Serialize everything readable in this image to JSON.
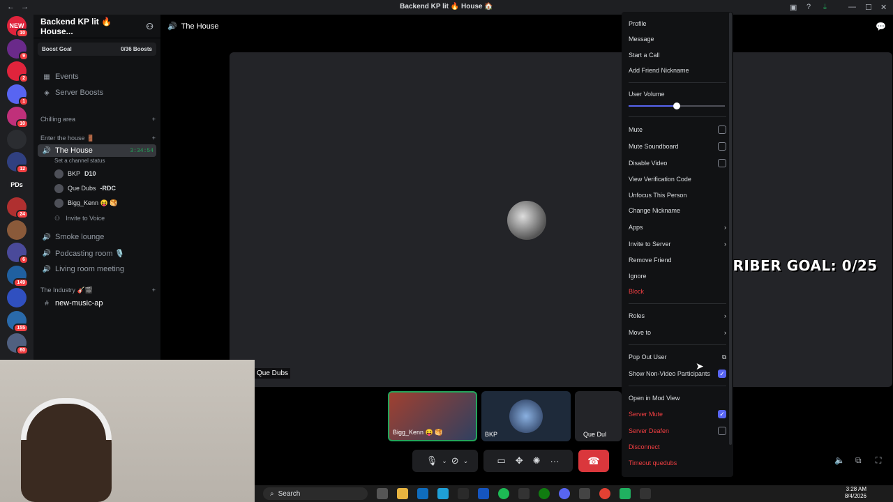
{
  "titlebar": {
    "title": "Backend KP lit 🔥 House 🏠"
  },
  "servers": [
    {
      "label": "NEW",
      "badge": "10",
      "color": "#e0243c"
    },
    {
      "label": "",
      "badge": "9",
      "color": "#6a2a8a"
    },
    {
      "label": "",
      "badge": "2",
      "color": "#e0243c"
    },
    {
      "label": "",
      "badge": "1",
      "color": "#5865f2"
    },
    {
      "label": "",
      "badge": "10",
      "color": "#c0307a"
    },
    {
      "label": "",
      "badge": "",
      "color": "#2b2d31"
    },
    {
      "label": "",
      "badge": "12",
      "color": "#304080"
    },
    {
      "label": "PDs",
      "badge": "",
      "color": "#1e1f22"
    },
    {
      "label": "",
      "badge": "24",
      "color": "#b03030"
    },
    {
      "label": "",
      "badge": "",
      "color": "#8a5a3a"
    },
    {
      "label": "",
      "badge": "6",
      "color": "#4a4a9a"
    },
    {
      "label": "",
      "badge": "149",
      "color": "#2060a0"
    },
    {
      "label": "",
      "badge": "",
      "color": "#3050c0"
    },
    {
      "label": "",
      "badge": "155",
      "color": "#2a6aaa"
    },
    {
      "label": "",
      "badge": "60",
      "color": "#506080"
    }
  ],
  "guild": {
    "name": "Backend KP lit 🔥 House...",
    "boost_label": "Boost Goal",
    "boost_count": "0/36 Boosts"
  },
  "channels": {
    "events": "Events",
    "server_boosts": "Server Boosts",
    "cat_chilling": "Chilling area",
    "cat_enter": "Enter the house 🚪",
    "the_house": "The House",
    "the_house_time": "3:34:54",
    "channel_status": "Set a channel status",
    "voice_users": [
      {
        "name": "BKP",
        "tag": "D10"
      },
      {
        "name": "Que Dubs",
        "tag": "-RDC"
      },
      {
        "name": "Bigg_Kenn 😝 🥞",
        "tag": ""
      }
    ],
    "invite": "Invite to Voice",
    "smoke_lounge": "Smoke lounge",
    "podcasting": "Podcasting room 🎙️",
    "living_room": "Living room meeting",
    "cat_industry": "The Industry 🎸🎬",
    "new_music": "new-music-ap"
  },
  "main": {
    "header": "The House",
    "overlay_text": "SUBSCRIBER GOAL: 0/25",
    "quedubs_label": "Que Dubs",
    "tiles": [
      {
        "label": "Bigg_Kenn 😝 🥞"
      },
      {
        "label": "BKP"
      },
      {
        "label": "Que Dul"
      }
    ]
  },
  "menu": {
    "profile": "Profile",
    "message": "Message",
    "start_call": "Start a Call",
    "add_nickname": "Add Friend Nickname",
    "user_volume": "User Volume",
    "user_volume_level": 0.5,
    "mute": "Mute",
    "mute_soundboard": "Mute Soundboard",
    "disable_video": "Disable Video",
    "view_verification": "View Verification Code",
    "unfocus": "Unfocus This Person",
    "change_nickname": "Change Nickname",
    "apps": "Apps",
    "invite_server": "Invite to Server",
    "remove_friend": "Remove Friend",
    "ignore": "Ignore",
    "block": "Block",
    "roles": "Roles",
    "move_to": "Move to",
    "pop_out": "Pop Out User",
    "show_non_video": "Show Non-Video Participants",
    "open_mod_view": "Open in Mod View",
    "server_mute": "Server Mute",
    "server_deafen": "Server Deafen",
    "disconnect": "Disconnect",
    "timeout": "Timeout quedubs"
  },
  "taskbar": {
    "search": "Search",
    "time": "3:28 AM",
    "date": "8/4/2026"
  }
}
